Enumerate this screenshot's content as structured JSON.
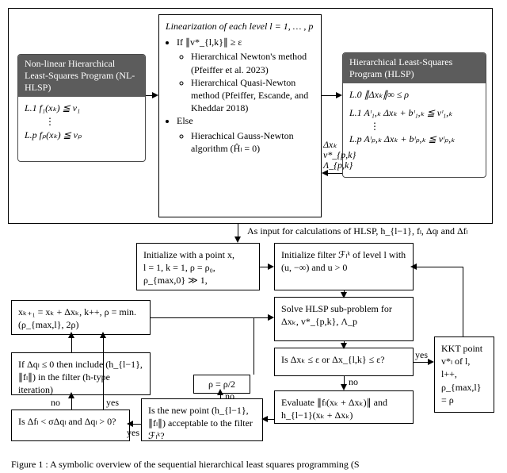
{
  "caption": "Figure 1 : A symbolic overview of the sequential hierarchical least squares programming (S",
  "nlhlsp": {
    "title": "Non-linear Hierarchical Least-Squares Program (NL-HLSP)",
    "l1": "L.1   f₁(xₖ) ≦ v₁",
    "dots": "⋮",
    "lp": "L.p   fₚ(xₖ) ≦ vₚ"
  },
  "lin": {
    "title": "Linearization of each level l = 1, … , p",
    "bullet_if": "If ∥v*_{l,k}∥ ≥ ε",
    "sub_newton": "Hierarchical Newton's method (Pfeiffer et al. 2023)",
    "sub_quasi": "Hierarchical Quasi-Newton method (Pfeiffer, Escande, and Kheddar 2018)",
    "bullet_else": "Else",
    "sub_gauss": "Hierachical Gauss-Newton algorithm (Ĥₗ = 0)"
  },
  "hlsp": {
    "title": "Hierarchical Least-Squares Program (HLSP)",
    "l0": "L.0   ∥Δxₖ∥∞ ≤ ρ",
    "l1": "L.1   Aᶦ₁,ₖ Δxₖ + bᶦ₁,ₖ ≦ vᶦ₁,ₖ",
    "dots": "⋮",
    "lp": "L.p   Aᶦₚ,ₖ Δxₖ + bᶦₚ,ₖ ≦ vᶦₚ,ₖ"
  },
  "arrow_back_label": "Δxₖ\nv*_{p,k}\nΛ_{p,k}",
  "below_label": "As input for calculations of HLSP, h_{l−1}, fₗ, Δqₗ and Δfₗ",
  "init_left": "Initialize with a point x,\nl = 1, k = 1, ρ = ρ₀,\nρ_{max,0} ≫ 1,",
  "init_filter": "Initialize filter ℱₗᵏ of level l with (u, −∞) and u > 0",
  "solve": "Solve HLSP sub-problem for Δxₖ, v*_{p,k}, Λ_p",
  "kkt": "KKT point v*ₗ of l, l++, ρ_{max,l} = ρ",
  "eps_check": "Is Δxₖ ≤ ε or Δx_{l,k} ≤ ε?",
  "eval": "Evaluate ∥fₗ(xₖ + Δxₖ)∥ and h_{l−1}(xₖ + Δxₖ)",
  "filter_check": "Is the new point (h_{l−1}, ∥fₗ∥) acceptable to the filter ℱₗᵏ?",
  "rho_half": "ρ = ρ/2",
  "df_check": "Is Δfₗ < σΔqₗ and Δqₗ > 0?",
  "step": "xₖ₊₁ = xₖ + Δxₖ, k++, ρ = min.(ρ_{max,l}, 2ρ)",
  "include": "If Δqₗ ≤ 0 then include (h_{l−1}, ∥fₗ∥) in the filter (h-type iteration)",
  "yes": "yes",
  "no": "no"
}
